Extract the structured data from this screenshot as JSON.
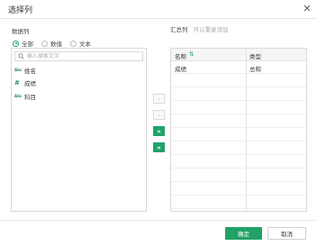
{
  "dialog": {
    "title": "选择列"
  },
  "left": {
    "label": "数据列",
    "radios": [
      {
        "label": "全部",
        "checked": true
      },
      {
        "label": "数值",
        "checked": false
      },
      {
        "label": "文本",
        "checked": false
      }
    ],
    "search_placeholder": "输入搜索文字",
    "fields": [
      {
        "type_icon": "Abc",
        "label": "姓名"
      },
      {
        "type_icon": "#",
        "label": "成绩"
      },
      {
        "type_icon": "Abc",
        "label": "科目"
      }
    ]
  },
  "right": {
    "label": "汇总列",
    "hint": "可以重复添加",
    "col_name": "名称",
    "col_type": "类型",
    "rows": [
      {
        "name": "成绩",
        "type": "总和"
      }
    ]
  },
  "middle": {
    "add_one": "›",
    "remove_one": "‹",
    "add_all": "»",
    "remove_all": "«"
  },
  "footer": {
    "ok": "确定",
    "cancel": "取消"
  },
  "colors": {
    "accent": "#21a366"
  }
}
